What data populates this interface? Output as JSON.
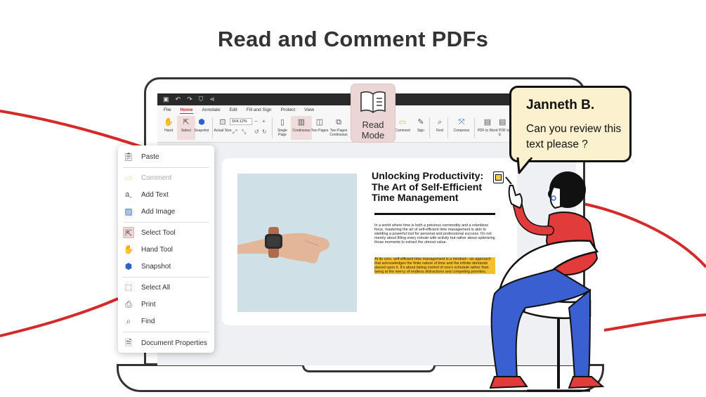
{
  "headline": "Read and Comment PDFs",
  "colors": {
    "accent": "#c52a2a",
    "highlight": "#f6c02a",
    "bubble": "#fbf1cf",
    "read_mode_bg": "#ecd5d5"
  },
  "titlebar": {
    "icons": [
      "save-icon",
      "undo-icon",
      "redo-icon",
      "shield-icon",
      "share-icon"
    ]
  },
  "menu": {
    "file": "File",
    "home": "Home",
    "annotate": "Annotate",
    "edit": "Edit",
    "fill_sign": "Fill and Sign",
    "protect": "Protect",
    "view": "View"
  },
  "ribbon": {
    "hand": "Hand",
    "select": "Select",
    "snapshot": "Snapshot",
    "actual_size": "Actual Size",
    "zoom_value": "164.12%",
    "single_page": "Single Page",
    "continuous": "Continuous",
    "two_pages": "Two Pages",
    "two_pages_continuous": "Two Pages Continuous",
    "comment": "Comment",
    "sign": "Sign",
    "find": "Find",
    "compress": "Compress",
    "pdf_to_word": "PDF to Word",
    "pdf_to_e": "PDF to E"
  },
  "read_mode": {
    "line1": "Read",
    "line2": "Mode"
  },
  "context_menu": {
    "paste": "Paste",
    "comment": "Comment",
    "add_text": "Add Text",
    "add_image": "Add Image",
    "select_tool": "Select Tool",
    "hand_tool": "Hand Tool",
    "snapshot": "Snapshot",
    "select_all": "Select All",
    "print": "Print",
    "find": "Find",
    "document_properties": "Document Properties"
  },
  "document": {
    "title": "Unlocking Productivity: The Art of Self-Efficient Time Management",
    "para1": "In a world where time is both a precious commodity and a relentless force, mastering the art of self-efficient time management is akin to wielding a powerful tool for personal and professional success. It's not merely about filling every minute with activity but rather about optimizing those moments to extract the utmost value.",
    "para2": "At its core, self-efficient time management is a mindset—an approach that acknowledges the finite nature of time and the infinite demands placed upon it. It's about taking control of one's schedule rather than being at the mercy of endless distractions and competing priorities."
  },
  "bubble": {
    "name": "Janneth B.",
    "message": "Can you review this text please ?"
  }
}
